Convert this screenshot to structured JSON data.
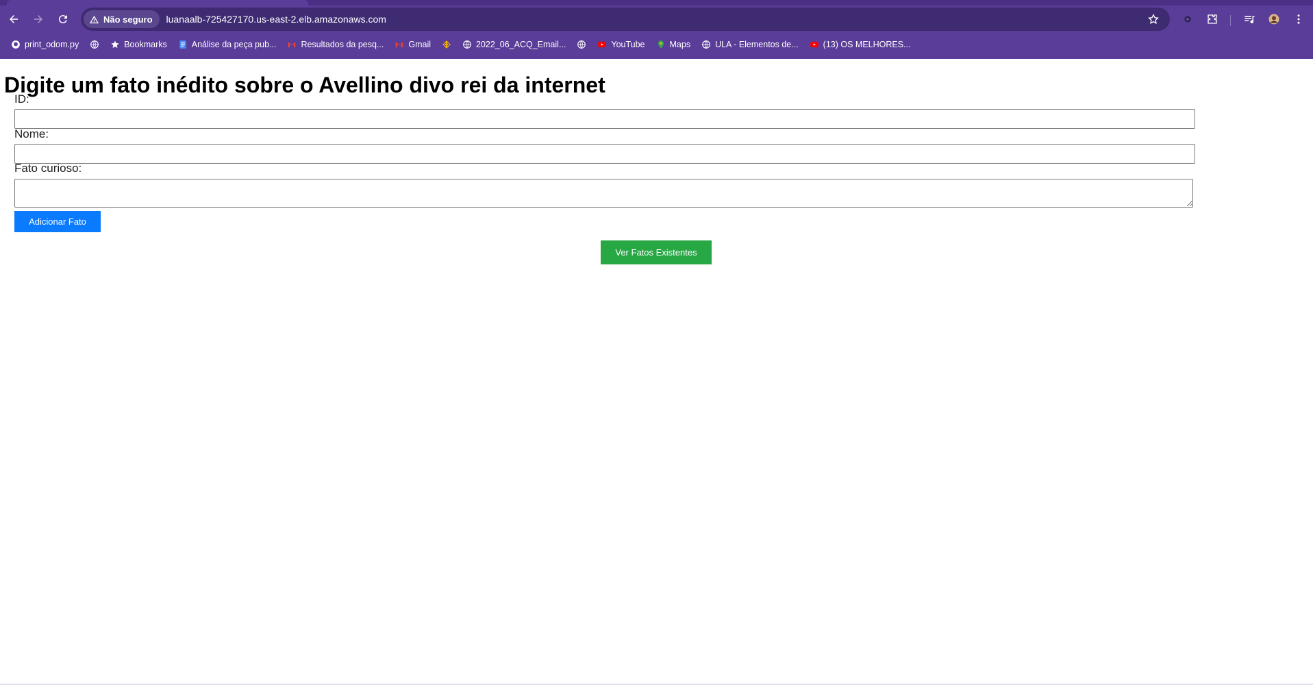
{
  "browser": {
    "security_label": "Não seguro",
    "url": "luanaalb-725427170.us-east-2.elb.amazonaws.com",
    "bookmarks": [
      {
        "label": "print_odom.py",
        "icon": "github-icon"
      },
      {
        "label": "",
        "icon": "globe-icon"
      },
      {
        "label": "Bookmarks",
        "icon": "star-icon"
      },
      {
        "label": "Análise da peça pub...",
        "icon": "docs-icon"
      },
      {
        "label": "Resultados da pesq...",
        "icon": "gmail-icon"
      },
      {
        "label": "Gmail",
        "icon": "gmail-icon"
      },
      {
        "label": "",
        "icon": "code-icon"
      },
      {
        "label": "2022_06_ACQ_Email...",
        "icon": "globe-icon"
      },
      {
        "label": "",
        "icon": "globe-icon"
      },
      {
        "label": "YouTube",
        "icon": "youtube-icon"
      },
      {
        "label": "Maps",
        "icon": "maps-icon"
      },
      {
        "label": "ULA - Elementos de...",
        "icon": "globe-icon"
      },
      {
        "label": "(13) OS MELHORES...",
        "icon": "youtube-icon"
      }
    ]
  },
  "page": {
    "title": "Digite um fato inédito sobre o Avellino divo rei da internet",
    "form": {
      "id_label": "ID:",
      "id_value": "",
      "name_label": "Nome:",
      "name_value": "",
      "fact_label": "Fato curioso:",
      "fact_value": "",
      "submit_label": "Adicionar Fato"
    },
    "view_button_label": "Ver Fatos Existentes"
  },
  "colors": {
    "chrome": "#5a3d98",
    "primary_button": "#0a7bff",
    "success_button": "#28a745"
  }
}
